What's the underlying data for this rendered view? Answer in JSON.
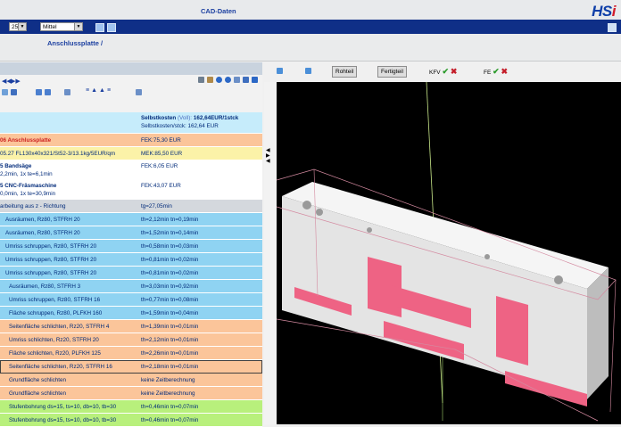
{
  "app": {
    "title": "CAD-Daten",
    "logo": "HSi"
  },
  "toolbar": {
    "size_select": "25",
    "quality_select": "Mittel",
    "icons": [
      "windows-icon",
      "grid-icon",
      "settings-icon"
    ]
  },
  "breadcrumb": {
    "label": "Anschlussplatte /"
  },
  "left_panel": {
    "tool_icons": [
      "first-icon",
      "last-icon",
      "list-icon",
      "move-icon",
      "align-icon",
      "sort-icon",
      "settings-icon"
    ],
    "right_icons": [
      "print-icon",
      "user-icon",
      "info-icon",
      "help-icon",
      "export-icon",
      "close-icon"
    ],
    "header": {
      "left": "",
      "cost_title": "Selbstkosten",
      "cost_type": "(Voll):",
      "cost_value": "162,64EUR/1stck",
      "cost_sub": "Selbstkosten/stck: 162,64 EUR"
    },
    "rows": [
      {
        "left": "06 Anschlussplatte",
        "right": "FEK:75,30 EUR",
        "color": "orange",
        "bold": true,
        "red": true
      },
      {
        "left": "05.27 FL130x40x321/St52-3/13.1kg/5EUR/qm",
        "right": "MEK:85,50 EUR",
        "color": "yellow"
      },
      {
        "left": "5 Bandsäge",
        "left2": "2,2min, 1x te=6,1min",
        "right": "FEK:6,05 EUR",
        "color": "white",
        "tall": true
      },
      {
        "left": "5 CNC-Fräsmaschine",
        "left2": "0,0min, 1x te=30,9min",
        "right": "FEK:43,07 EUR",
        "color": "white",
        "tall": true
      },
      {
        "left": "arbeitung aus z - Richtung",
        "right": "tg=27,05min",
        "color": "grey"
      },
      {
        "left": "Ausräumen, Rz80, STFRH 20",
        "right": "th=2,12min tn=0,19min",
        "color": "blue",
        "indent": 6
      },
      {
        "left": "Ausräumen, Rz80, STFRH 20",
        "right": "th=1,52min tn=0,14min",
        "color": "blue",
        "indent": 6
      },
      {
        "left": "Umriss schruppen, Rz80, STFRH 20",
        "right": "th=0,58min tn=0,03min",
        "color": "blue",
        "indent": 6
      },
      {
        "left": "Umriss schruppen, Rz80, STFRH 20",
        "right": "th=0,81min tn=0,02min",
        "color": "blue",
        "indent": 6
      },
      {
        "left": "Umriss schruppen, Rz80, STFRH 20",
        "right": "th=0,81min tn=0,02min",
        "color": "blue",
        "indent": 6
      },
      {
        "left": "Ausräumen, Rz80, STFRH 3",
        "right": "th=3,03min tn=0,92min",
        "color": "blue",
        "indent": 10
      },
      {
        "left": "Umriss schruppen, Rz80, STFRH 16",
        "right": "th=0,77min tn=0,08min",
        "color": "blue",
        "indent": 10
      },
      {
        "left": "Fläche schruppen, Rz80, PLFKH 160",
        "right": "th=1,59min tn=0,04min",
        "color": "blue",
        "indent": 10
      },
      {
        "left": "Seitenfläche schlichten, Rz20, STFRH 4",
        "right": "th=1,39min tn=0,01min",
        "color": "orange",
        "indent": 10
      },
      {
        "left": "Umriss schlichten, Rz20, STFRH 20",
        "right": "th=2,12min tn=0,01min",
        "color": "orange",
        "indent": 10
      },
      {
        "left": "Fläche schlichten, Rz20, PLFKH 125",
        "right": "th=2,26min tn=0,01min",
        "color": "orange",
        "indent": 10
      },
      {
        "left": "Seitenfläche schlichten, Rz20, STFRH 16",
        "right": "th=2,18min tn=0,01min",
        "color": "orange",
        "indent": 10,
        "selected": true
      },
      {
        "left": "Grundfläche schlichten",
        "right": "keine Zeitberechnung",
        "color": "orange",
        "indent": 10
      },
      {
        "left": "Grundfläche schlichten",
        "right": "keine Zeitberechnung",
        "color": "orange",
        "indent": 10
      },
      {
        "left": "Stufenbohrung ds=15, ts=10, db=10, tb=30",
        "right": "th=0,46min tn=0,07min",
        "color": "green",
        "indent": 10
      },
      {
        "left": "Stufenbohrung ds=15, ts=10, db=10, tb=30",
        "right": "th=0,46min tn=0,07min",
        "color": "green",
        "indent": 10
      }
    ]
  },
  "viewer": {
    "buttons": {
      "rohteil": "Rohteil",
      "fertigteil": "Fertigteil"
    },
    "kfv_label": "KFV",
    "fe_label": "FE",
    "check": "✔",
    "cross": "✖"
  },
  "colors": {
    "navy": "#0f2f87",
    "accent_blue": "#1b3fa0",
    "row_blue": "#8fd3f2",
    "row_orange": "#fbc59a",
    "row_green": "#b8f07c",
    "row_yellow": "#fbf2a8",
    "part_grey": "#e4e4e4",
    "part_pink": "#ec5a7c",
    "viewport": "#000000"
  }
}
